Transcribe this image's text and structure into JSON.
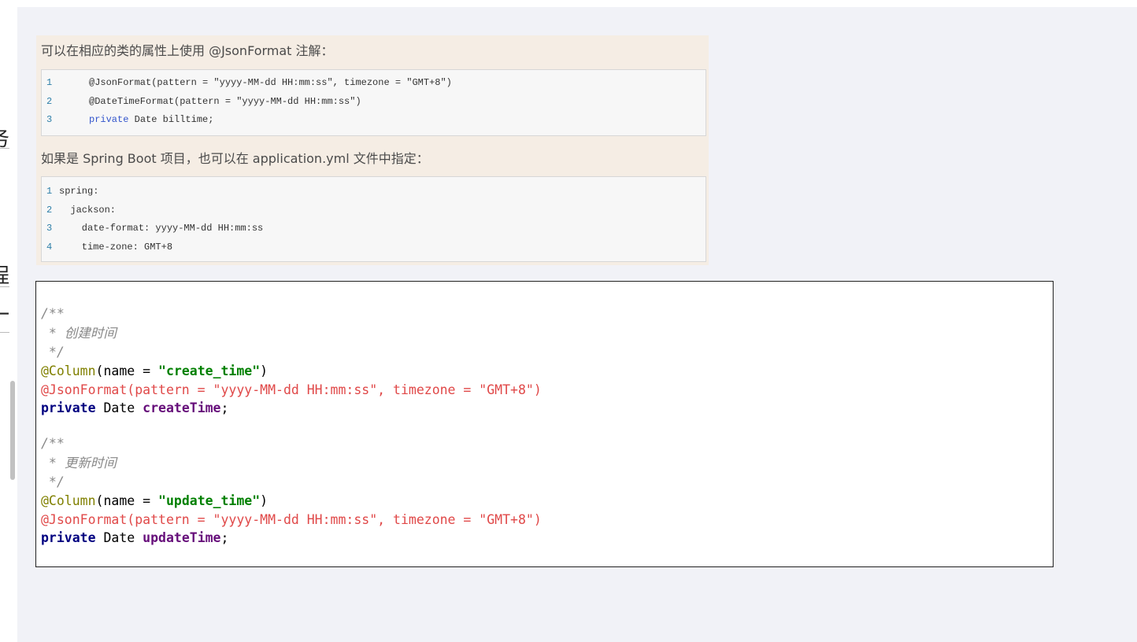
{
  "left_fragments": [
    "务",
    "程",
    "一"
  ],
  "quote_box": {
    "intro_text": "可以在相应的类的属性上使用 @JsonFormat 注解：",
    "snippet1": [
      {
        "n": "1",
        "code": "@JsonFormat(pattern = \"yyyy-MM-dd HH:mm:ss\", timezone = \"GMT+8\")"
      },
      {
        "n": "2",
        "code": "@DateTimeFormat(pattern = \"yyyy-MM-dd HH:mm:ss\")"
      },
      {
        "n": "3",
        "keyword": "private",
        "code": " Date billtime;"
      }
    ],
    "spring_text": "如果是 Spring Boot 项目，也可以在 application.yml 文件中指定：",
    "snippet2": [
      {
        "n": "1",
        "code": "spring:"
      },
      {
        "n": "2",
        "code": "  jackson:"
      },
      {
        "n": "3",
        "code": "    date-format: yyyy-MM-dd HH:mm:ss"
      },
      {
        "n": "4",
        "code": "    time-zone: GMT+8"
      }
    ]
  },
  "code_block": {
    "block1": {
      "comment_open": "/**",
      "comment_prefix": " * ",
      "comment_text": "创建时间",
      "comment_close": " */",
      "annotation": "@Column",
      "ann_open": "(name = ",
      "column_name": "\"create_time\"",
      "ann_close": ")",
      "json_format": "@JsonFormat(pattern = \"yyyy-MM-dd HH:mm:ss\", timezone = \"GMT+8\")",
      "keyword": "private",
      "type": " Date ",
      "field": "createTime",
      "semicolon": ";"
    },
    "block2": {
      "comment_open": "/**",
      "comment_prefix": " * ",
      "comment_text": "更新时间",
      "comment_close": " */",
      "annotation": "@Column",
      "ann_open": "(name = ",
      "column_name": "\"update_time\"",
      "ann_close": ")",
      "json_format": "@JsonFormat(pattern = \"yyyy-MM-dd HH:mm:ss\", timezone = \"GMT+8\")",
      "keyword": "private",
      "type": " Date ",
      "field": "updateTime",
      "semicolon": ";"
    }
  }
}
